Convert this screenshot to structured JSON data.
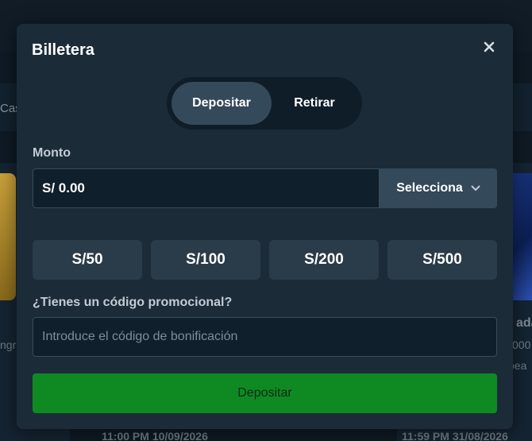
{
  "background": {
    "nav_text": "Cas",
    "left_text": "ngr",
    "right_title": "ada",
    "right_line1": "000",
    "right_line2": "pea",
    "date_left": "11:00 PM 10/09/2026",
    "date_right": "11:59 PM 31/08/2026"
  },
  "modal": {
    "title": "Billetera",
    "close_icon": "close-icon",
    "tabs": [
      {
        "label": "Depositar",
        "active": true
      },
      {
        "label": "Retirar",
        "active": false
      }
    ],
    "amount": {
      "label": "Monto",
      "value": "S/ 0.00",
      "currency_select": "Selecciona",
      "chevron_icon": "chevron-down-icon"
    },
    "quick_amounts": [
      "S/50",
      "S/100",
      "S/200",
      "S/500"
    ],
    "promo": {
      "label": "¿Tienes un código promocional?",
      "placeholder": "Introduce el código de bonificación"
    },
    "submit_label": "Depositar"
  },
  "colors": {
    "accent_green": "#0f8a23",
    "modal_bg": "#1b2b38",
    "active_tab": "#34495a"
  }
}
